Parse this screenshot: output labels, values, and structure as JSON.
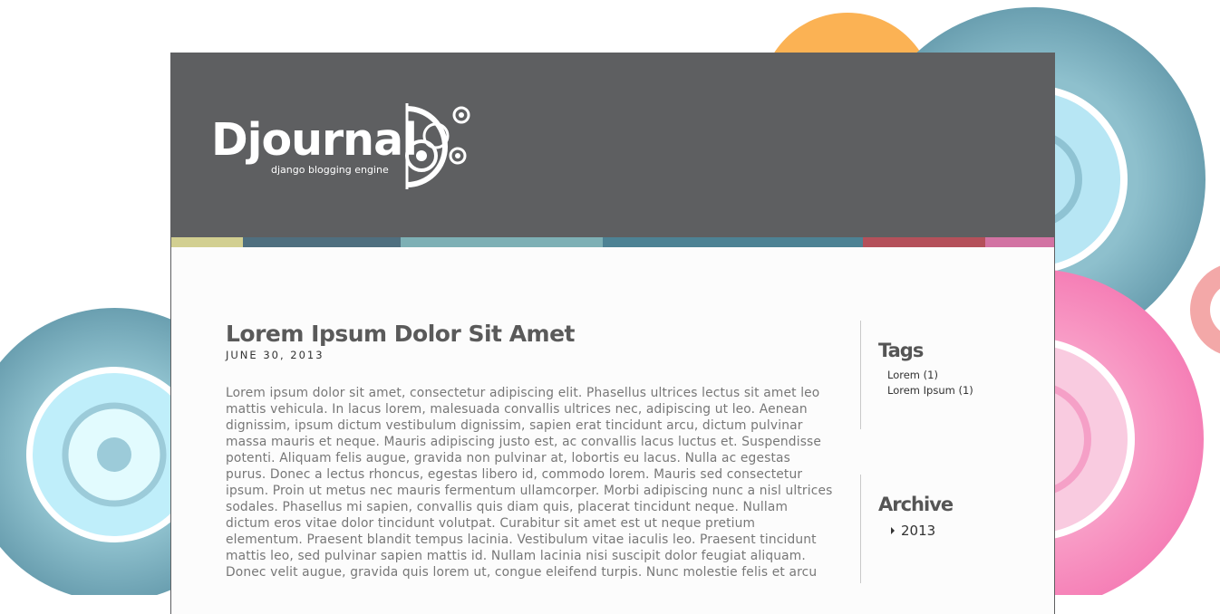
{
  "header": {
    "logo_text": "Djournal",
    "logo_tagline": "django blogging engine"
  },
  "colors": {
    "header_bg": "#5e5f61",
    "stripe": [
      "#d2cf91",
      "#4f6f7f",
      "#7eb0b5",
      "#4d8294",
      "#b4505a",
      "#d273a3"
    ],
    "circle_blue": "#7aaebd",
    "circle_orange": "#fbb254",
    "circle_pink": "#f88bbd"
  },
  "post": {
    "title": "Lorem Ipsum Dolor Sit Amet",
    "date": "JUNE 30, 2013",
    "body": "Lorem ipsum dolor sit amet, consectetur adipiscing elit. Phasellus ultrices lectus sit amet leo mattis vehicula. In lacus lorem, malesuada convallis ultrices nec, adipiscing ut leo. Aenean dignissim, ipsum dictum vestibulum dignissim, sapien erat tincidunt arcu, dictum pulvinar massa mauris et neque. Mauris adipiscing justo est, ac convallis lacus luctus et. Suspendisse potenti. Aliquam felis augue, gravida non pulvinar at, lobortis eu lacus. Nulla ac egestas purus. Donec a lectus rhoncus, egestas libero id, commodo lorem. Mauris sed consectetur ipsum. Proin ut metus nec mauris fermentum ullamcorper. Morbi adipiscing nunc a nisl ultrices sodales. Phasellus mi sapien, convallis quis diam quis, placerat tincidunt neque. Nullam dictum eros vitae dolor tincidunt volutpat. Curabitur sit amet est ut neque pretium elementum. Praesent blandit tempus lacinia. Vestibulum vitae iaculis leo. Praesent tincidunt mattis leo, sed pulvinar sapien mattis id. Nullam lacinia nisi suscipit dolor feugiat aliquam. Donec velit augue, gravida quis lorem ut, congue eleifend turpis. Nunc molestie felis et arcu"
  },
  "sidebar": {
    "tags": {
      "title": "Tags",
      "items": [
        "Lorem (1)",
        "Lorem Ipsum (1)"
      ]
    },
    "archive": {
      "title": "Archive",
      "items": [
        "2013"
      ]
    }
  }
}
